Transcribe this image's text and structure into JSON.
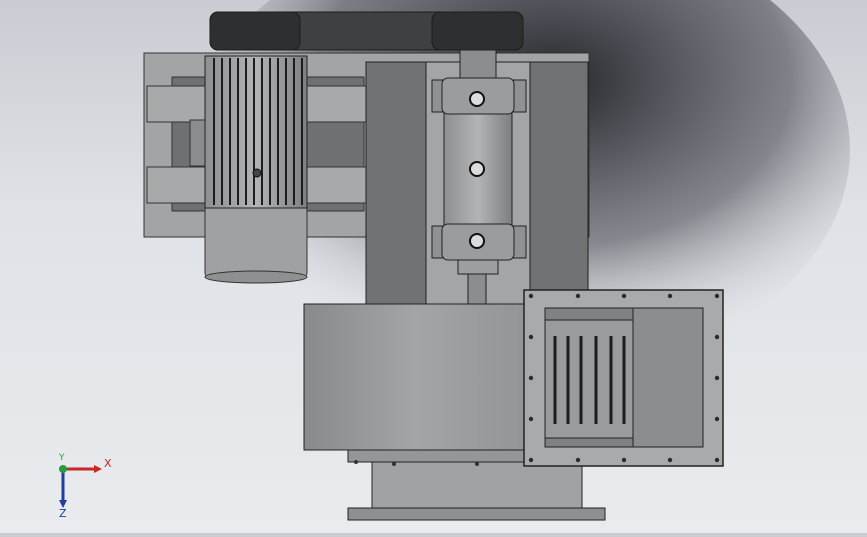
{
  "viewport": {
    "name": "cad-graphics-area",
    "background_top": "#c9ccd2",
    "background_bottom": "#e9ebee"
  },
  "triad": {
    "x_label": "X",
    "y_label": "Y",
    "z_label": "Z",
    "x_color": "#c62828",
    "y_color": "#2e9b3a",
    "z_color": "#1f3f9e"
  },
  "model": {
    "description_icon": "centrifugal-fan-assembly-icon",
    "part_color": "#9a9c9d",
    "dark_part_color": "#3a3b3d",
    "edge_color": "#222222"
  }
}
